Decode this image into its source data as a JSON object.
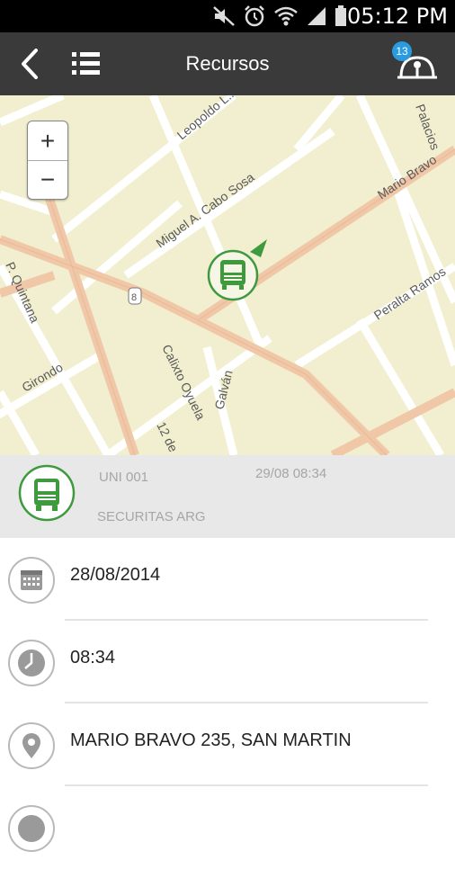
{
  "status_bar": {
    "time": "05:12 PM",
    "icons": [
      "mute-icon",
      "alarm-icon",
      "wifi-icon",
      "signal-icon",
      "battery-icon"
    ]
  },
  "app_bar": {
    "title": "Recursos",
    "notification_count": "13",
    "back_icon": "back-chevron-icon",
    "menu_icon": "list-icon",
    "notification_icon": "antenna-icon"
  },
  "map": {
    "street_labels": [
      "Leopoldo L...",
      "Palacios",
      "Mario Bravo",
      "Miguel A. Cabo Sosa",
      "P. Quintana",
      "8",
      "Peralta Ramos",
      "Girondo",
      "Calixto Oyuela",
      "Galván",
      "12 de"
    ],
    "zoom_in_label": "+",
    "zoom_out_label": "−",
    "marker": "truck-marker-icon"
  },
  "unit": {
    "name": "UNI 001",
    "date": "29/08 08:34",
    "company": "SECURITAS ARG",
    "icon": "truck-icon",
    "accent": "#3d9a3d"
  },
  "details": [
    {
      "icon": "calendar-icon",
      "value": "28/08/2014"
    },
    {
      "icon": "clock-icon",
      "value": "08:34"
    },
    {
      "icon": "location-pin-icon",
      "value": "MARIO BRAVO 235, SAN MARTIN"
    },
    {
      "icon": "info-icon",
      "value": ""
    }
  ]
}
